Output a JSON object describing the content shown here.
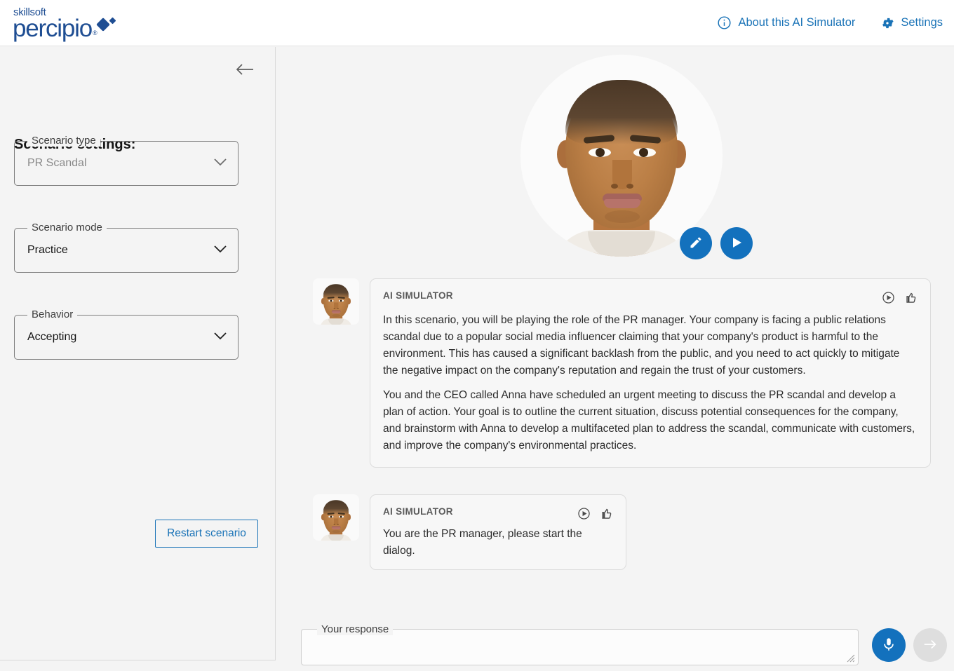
{
  "header": {
    "brand": {
      "top": "skillsoft",
      "name": "percipio",
      "tm": "®"
    },
    "about_label": "About this AI Simulator",
    "settings_label": "Settings",
    "about_icon": "info-circle-icon",
    "settings_icon": "gear-icon",
    "link_color": "#1a73b7",
    "brand_color": "#1f4e93"
  },
  "sidebar": {
    "back_icon": "arrow-left-icon",
    "title": "Scenario settings:",
    "fields": [
      {
        "label": "Scenario type",
        "value": "PR Scandal",
        "disabled": true
      },
      {
        "label": "Scenario mode",
        "value": "Practice",
        "disabled": false
      },
      {
        "label": "Behavior",
        "value": "Accepting",
        "disabled": false
      }
    ],
    "restart_label": "Restart scenario"
  },
  "hero": {
    "avatar_name": "ai-avatar-portrait",
    "edit_icon": "pencil-icon",
    "play_icon": "play-icon",
    "accent_color": "#1371bd"
  },
  "chat": {
    "messages": [
      {
        "speaker": "AI SIMULATOR",
        "play_icon": "play-circle-icon",
        "like_icon": "thumbs-up-icon",
        "paragraphs": [
          "In this scenario, you will be playing the role of the PR manager. Your company is facing a public relations scandal due to a popular social media influencer claiming that your company's product is harmful to the environment. This has caused a significant backlash from the public, and you need to act quickly to mitigate the negative impact on the company's reputation and regain the trust of your customers.",
          "You and the CEO called Anna have scheduled an urgent meeting to discuss the PR scandal and develop a plan of action. Your goal is to outline the current situation, discuss potential consequences for the company, and brainstorm with Anna to develop a multifaceted plan to address the scandal, communicate with customers, and improve the company's environmental practices."
        ]
      },
      {
        "speaker": "AI SIMULATOR",
        "play_icon": "play-circle-icon",
        "like_icon": "thumbs-up-icon",
        "paragraphs": [
          "You are the PR manager, please start the dialog."
        ]
      }
    ]
  },
  "response": {
    "label": "Your response",
    "value": "",
    "placeholder": "",
    "mic_icon": "microphone-icon",
    "send_icon": "arrow-right-icon",
    "mic_color": "#1371bd",
    "send_color": "#dedede"
  }
}
